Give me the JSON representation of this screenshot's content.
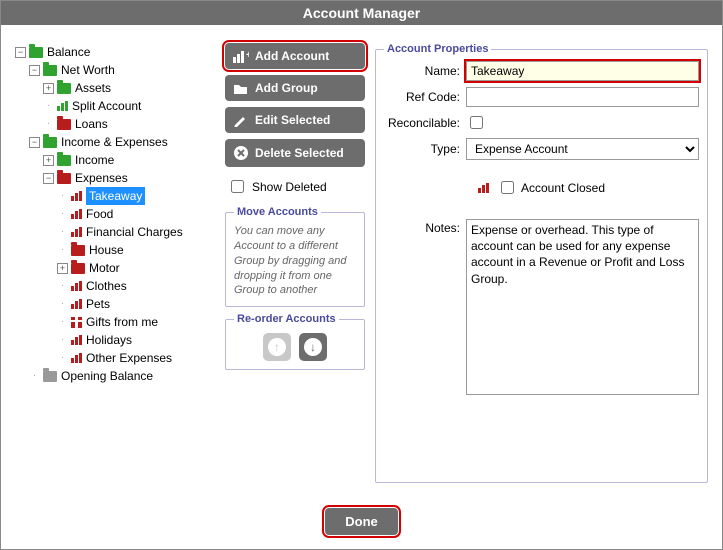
{
  "window": {
    "title": "Account Manager"
  },
  "tree": {
    "root": "Balance",
    "netWorth": {
      "label": "Net Worth",
      "assets": "Assets",
      "split": "Split Account",
      "loans": "Loans"
    },
    "ie": {
      "label": "Income & Expenses",
      "income": "Income",
      "expenses": "Expenses"
    },
    "expenseItems": [
      "Takeaway",
      "Food",
      "Financial Charges",
      "House",
      "Motor",
      "Clothes",
      "Pets",
      "Gifts from me",
      "Holidays",
      "Other Expenses"
    ],
    "opening": "Opening Balance"
  },
  "buttons": {
    "add_account": "Add Account",
    "add_group": "Add Group",
    "edit_selected": "Edit Selected",
    "delete_selected": "Delete Selected",
    "show_deleted": "Show Deleted",
    "done": "Done"
  },
  "move": {
    "legend": "Move Accounts",
    "hint": "You can move any Account to a different Group by dragging and dropping it from one Group to another"
  },
  "reorder": {
    "legend": "Re-order Accounts"
  },
  "props": {
    "legend": "Account Properties",
    "name_label": "Name:",
    "name_value": "Takeaway",
    "ref_label": "Ref Code:",
    "ref_value": "",
    "reconcilable_label": "Reconcilable:",
    "type_label": "Type:",
    "type_value": "Expense Account",
    "closed_label": "Account Closed",
    "notes_label": "Notes:",
    "notes_value": "Expense or overhead. This type of account can be used for any expense account in a Revenue or Profit and Loss Group."
  }
}
